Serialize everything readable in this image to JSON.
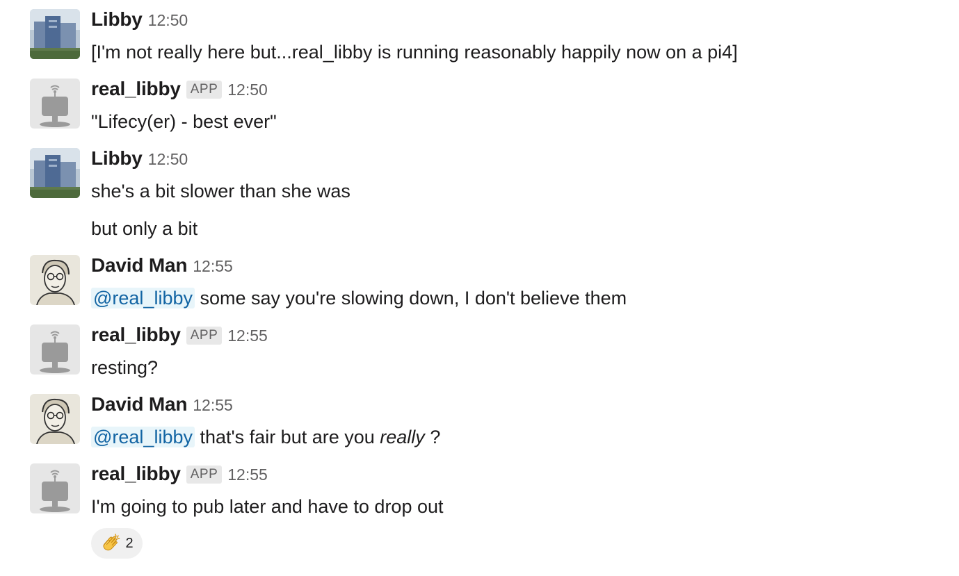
{
  "messages": [
    {
      "author": "Libby",
      "time": "12:50",
      "avatar": "building-photo-avatar",
      "lines": [
        "[I'm not really here but...real_libby is running reasonably happily now on a pi4]"
      ]
    },
    {
      "author": "real_libby",
      "badge": "APP",
      "time": "12:50",
      "avatar": "robot-avatar",
      "lines": [
        "\"Lifecy(er) - best ever\""
      ]
    },
    {
      "author": "Libby",
      "time": "12:50",
      "avatar": "building-photo-avatar",
      "lines": [
        "she's a bit slower than she was",
        "but only a bit"
      ]
    },
    {
      "author": "David Man",
      "time": "12:55",
      "avatar": "sketch-portrait-avatar",
      "mention": "@real_libby",
      "lines": [
        " some say you're slowing down, I don't believe them"
      ]
    },
    {
      "author": "real_libby",
      "badge": "APP",
      "time": "12:55",
      "avatar": "robot-avatar",
      "lines": [
        "resting?"
      ]
    },
    {
      "author": "David Man",
      "time": "12:55",
      "avatar": "sketch-portrait-avatar",
      "mention": "@real_libby",
      "text_before_italic": " that's fair but are you ",
      "italic": "really",
      "text_after_italic": " ?"
    },
    {
      "author": "real_libby",
      "badge": "APP",
      "time": "12:55",
      "avatar": "robot-avatar",
      "lines": [
        "I'm going to pub later and have to drop out"
      ],
      "reaction": {
        "emoji": "clapping-hands-icon",
        "count": "2"
      }
    }
  ],
  "colors": {
    "mention_bg": "#e8f5fa",
    "mention_text": "#1264a3",
    "badge_bg": "#e8e8e8",
    "timestamp": "#616061",
    "reaction_bg": "#f0f0f0"
  }
}
